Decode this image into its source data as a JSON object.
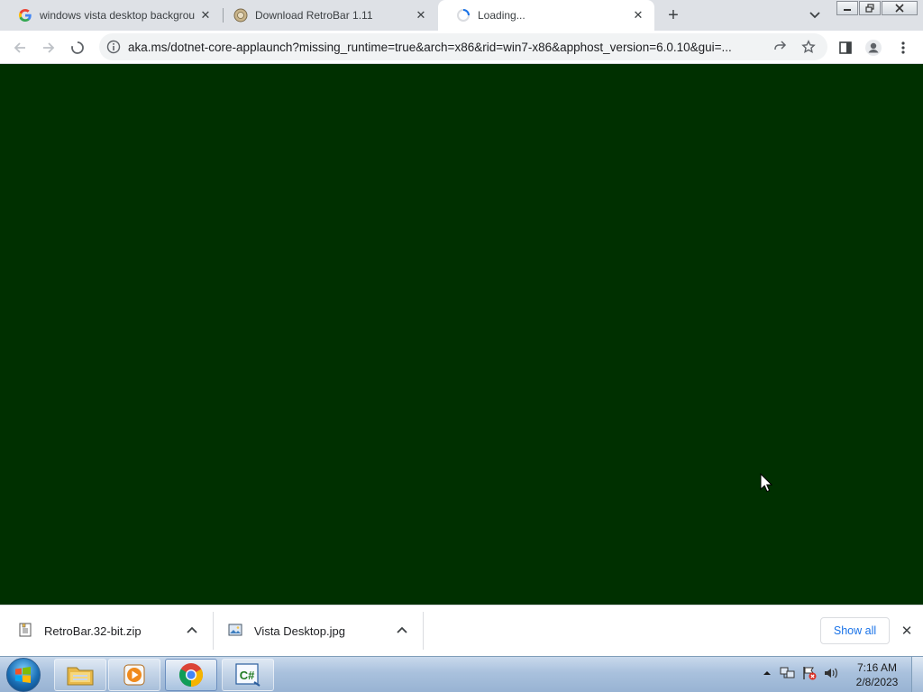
{
  "browser": {
    "tabs": [
      {
        "title": "windows vista desktop backgrou",
        "favicon": "google-g-icon",
        "active": false
      },
      {
        "title": "Download RetroBar 1.11",
        "favicon": "retrobar-favicon",
        "active": false
      },
      {
        "title": "Loading...",
        "favicon": "loading-spinner-icon",
        "active": true
      }
    ],
    "new_tab_label": "+",
    "address_url": "aka.ms/dotnet-core-applaunch?missing_runtime=true&arch=x86&rid=win7-x86&apphost_version=6.0.10&gui=..."
  },
  "content": {
    "background_color": "#003000"
  },
  "downloads": {
    "items": [
      {
        "name": "RetroBar.32-bit.zip",
        "icon": "zip-file-icon"
      },
      {
        "name": "Vista Desktop.jpg",
        "icon": "image-file-icon"
      }
    ],
    "show_all_label": "Show all"
  },
  "taskbar": {
    "apps": [
      {
        "name": "windows-explorer",
        "icon": "folder-icon"
      },
      {
        "name": "media-player",
        "icon": "media-player-icon"
      },
      {
        "name": "chrome",
        "icon": "chrome-icon"
      },
      {
        "name": "csharp-app",
        "icon": "csharp-icon",
        "label": "C#"
      }
    ],
    "clock": {
      "time": "7:16 AM",
      "date": "2/8/2023"
    }
  },
  "colors": {
    "tabstrip": "#dee1e6",
    "content_bg": "#003000",
    "accent": "#1a73e8"
  }
}
